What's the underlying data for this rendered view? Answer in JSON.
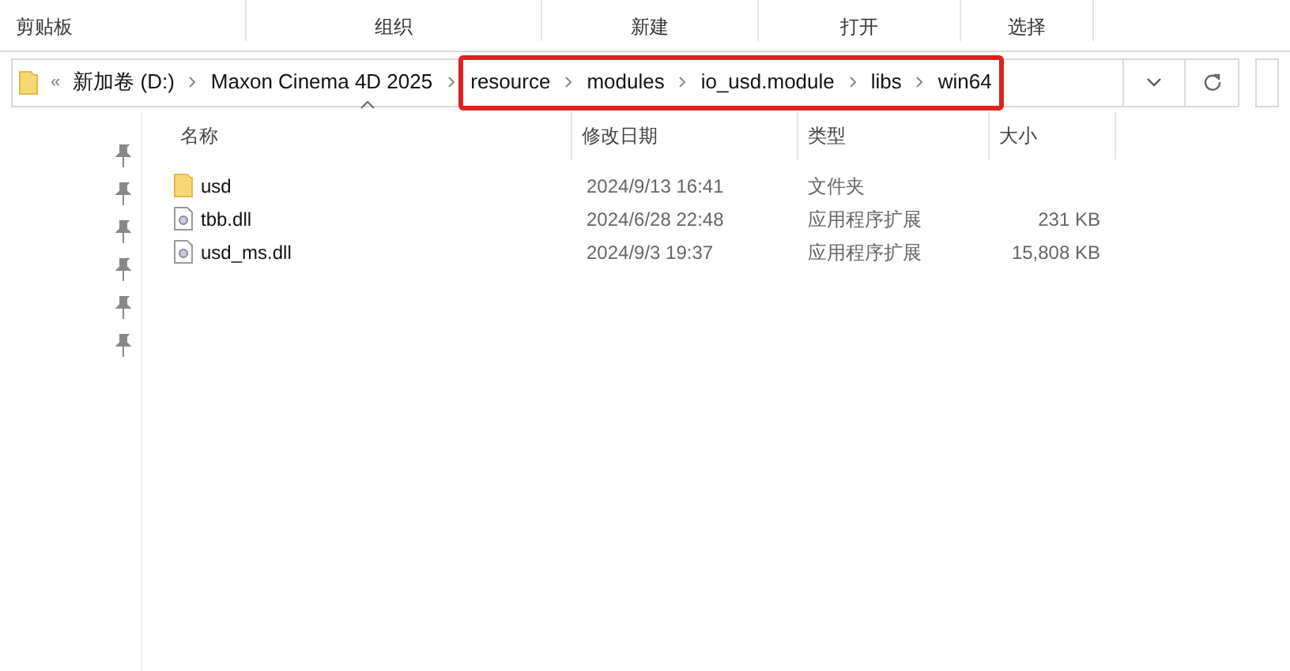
{
  "ribbon": {
    "groups": [
      "剪贴板",
      "组织",
      "新建",
      "打开",
      "选择"
    ]
  },
  "address_bar": {
    "overflow": "«",
    "segments": [
      {
        "label": "新加卷 (D:)",
        "highlighted": false
      },
      {
        "label": "Maxon Cinema 4D 2025",
        "highlighted": false
      },
      {
        "label": "resource",
        "highlighted": true
      },
      {
        "label": "modules",
        "highlighted": true
      },
      {
        "label": "io_usd.module",
        "highlighted": true
      },
      {
        "label": "libs",
        "highlighted": true
      },
      {
        "label": "win64",
        "highlighted": true
      }
    ]
  },
  "table": {
    "columns": [
      {
        "label": "名称",
        "sorted": true
      },
      {
        "label": "修改日期",
        "sorted": false
      },
      {
        "label": "类型",
        "sorted": false
      },
      {
        "label": "大小",
        "sorted": false
      }
    ],
    "rows": [
      {
        "kind": "folder",
        "name": "usd",
        "modified": "2024/9/13 16:41",
        "type": "文件夹"
      },
      {
        "kind": "dll",
        "name": "tbb.dll",
        "modified": "2024/6/28 22:48",
        "type": "应用程序扩展",
        "size": "231 KB"
      },
      {
        "kind": "dll",
        "name": "usd_ms.dll",
        "modified": "2024/9/3 19:37",
        "type": "应用程序扩展",
        "size": "15,808 KB"
      }
    ]
  }
}
